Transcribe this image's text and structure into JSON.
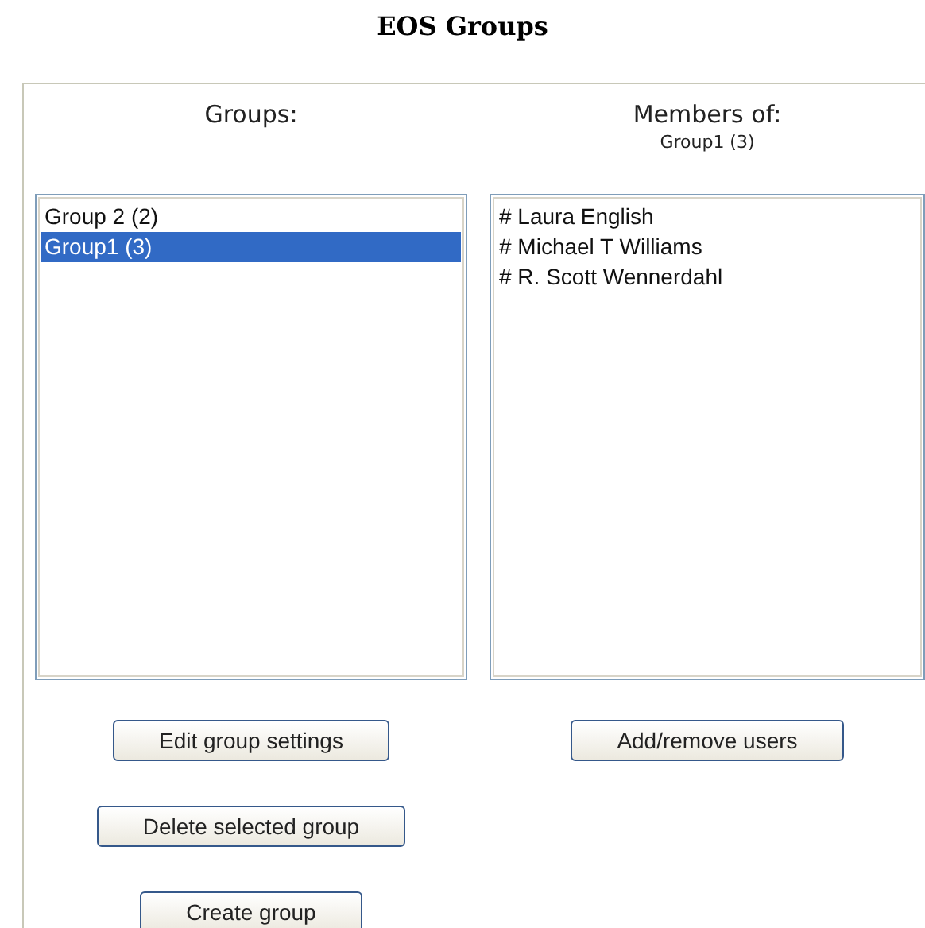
{
  "title": "EOS Groups",
  "groups": {
    "heading": "Groups:",
    "items": [
      {
        "label": "Group 2 (2)",
        "selected": false
      },
      {
        "label": "Group1 (3)",
        "selected": true
      }
    ],
    "buttons": [
      "Edit group settings",
      "Delete selected group",
      "Create group"
    ]
  },
  "members": {
    "heading": "Members of:",
    "subheading": "Group1 (3)",
    "items": [
      "# Laura English",
      "# Michael T Williams",
      "# R. Scott Wennerdahl"
    ],
    "buttons": [
      "Add/remove users"
    ]
  }
}
